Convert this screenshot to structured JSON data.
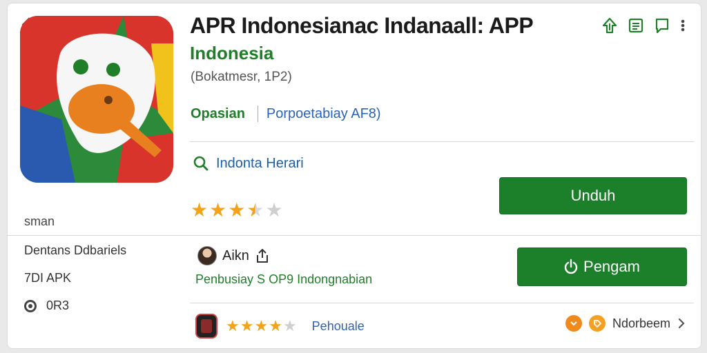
{
  "header": {
    "title": "APR Indonesianac Indanaall: APP",
    "subtitle": "Indonesia",
    "meta": "(Bokatmesr, 1P2)"
  },
  "tabs": {
    "primary": "Opasian",
    "secondary": "Porpoetabiay AF8)"
  },
  "search": {
    "label": "Indonta Herari"
  },
  "rating": {
    "stars": 3.5,
    "max": 5
  },
  "buttons": {
    "download": "Unduh",
    "install": "Pengam"
  },
  "left_column": {
    "small_label": "sman",
    "developer": "Dentans Ddbariels",
    "type": "7DI APK",
    "version": "0R3"
  },
  "author": {
    "name": "Aikn"
  },
  "description": "Penbusiay S OP9 Indongnabian",
  "bottom": {
    "stars": 4,
    "max": 5,
    "link": "Pehouale",
    "right_label": "Ndorbeem"
  },
  "colors": {
    "green": "#1c7f2a",
    "blue": "#2a63b8",
    "star": "#f2a31b",
    "orange": "#f08a1c"
  }
}
